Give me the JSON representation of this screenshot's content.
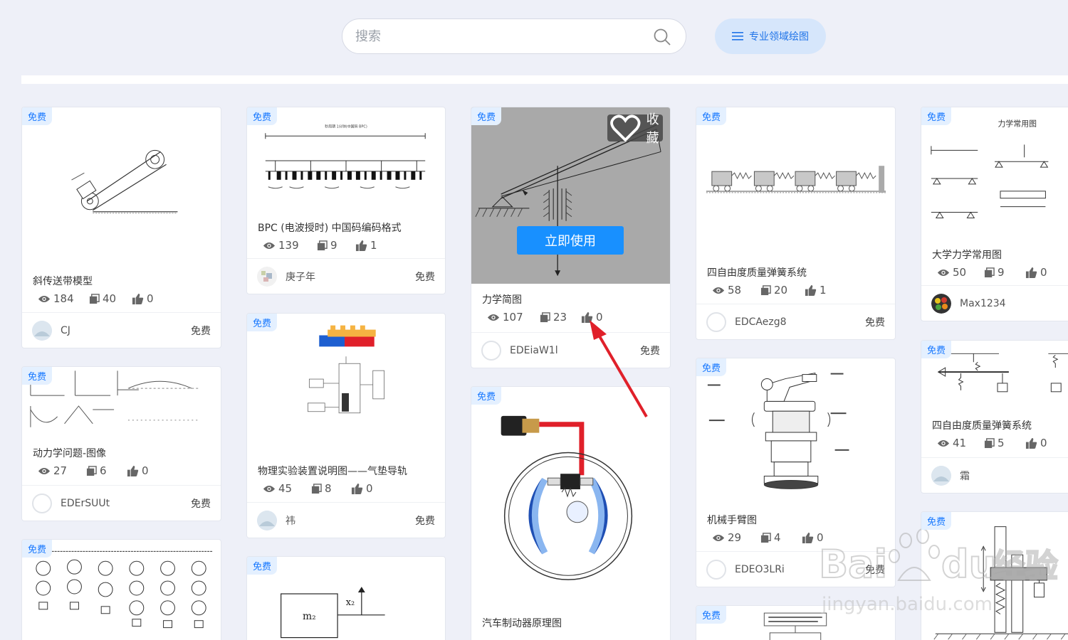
{
  "search": {
    "placeholder": "搜索"
  },
  "domain_button": {
    "label": "专业领域绘图"
  },
  "overlay": {
    "favorite": "收藏",
    "use_now": "立即使用"
  },
  "cards": [
    {
      "tag": "免费",
      "title": "斜传送带模型",
      "views": "184",
      "copies": "40",
      "likes": "0",
      "author": "CJ",
      "price": "免费"
    },
    {
      "tag": "免费",
      "title": "动力学问题-图像",
      "views": "27",
      "copies": "6",
      "likes": "0",
      "author": "EDErSUUt",
      "price": "免费"
    },
    {
      "tag": "免费"
    },
    {
      "tag": "免费",
      "title": "BPC (电波授时) 中国码编码格式",
      "views": "139",
      "copies": "9",
      "likes": "1",
      "author": "庚子年",
      "price": "免费",
      "thumb_title": "秒周期 1分钟(中国码 BPC)"
    },
    {
      "tag": "免费",
      "title": "物理实验装置说明图——气垫导轨",
      "views": "45",
      "copies": "8",
      "likes": "0",
      "author": "祎",
      "price": "免费"
    },
    {
      "tag": "免费",
      "thumb_label_m": "m₂",
      "thumb_label_x": "x₂"
    },
    {
      "tag": "免费",
      "title": "力学简图",
      "views": "107",
      "copies": "23",
      "likes": "0",
      "author": "EDEiaW1l",
      "price": "免费"
    },
    {
      "tag": "免费",
      "title": "汽车制动器原理图"
    },
    {
      "tag": "免费",
      "title": "四自由度质量弹簧系统",
      "views": "58",
      "copies": "20",
      "likes": "1",
      "author": "EDCAezg8",
      "price": "免费"
    },
    {
      "tag": "免费",
      "title": "机械手臂图",
      "views": "29",
      "copies": "4",
      "likes": "0",
      "author": "EDEO3LRi",
      "price": "免费"
    },
    {
      "tag": "免费"
    },
    {
      "tag": "免费",
      "title": "大学力学常用图",
      "views": "50",
      "copies": "9",
      "likes": "0",
      "author": "Max1234",
      "thumb_title": "力学常用图"
    },
    {
      "tag": "免费",
      "title": "四自由度质量弹簧系统",
      "views": "41",
      "copies": "5",
      "likes": "0",
      "author": "霜"
    },
    {
      "tag": "免费"
    }
  ],
  "watermark": {
    "brand": "Bai",
    "brand2": "du",
    "cn": "经验",
    "url": "jingyan.baidu.com"
  },
  "colors": {
    "accent": "#1890ff",
    "tag_bg": "#e4f0ff",
    "arrow": "#e0202a",
    "page_bg": "#eef0f8"
  }
}
